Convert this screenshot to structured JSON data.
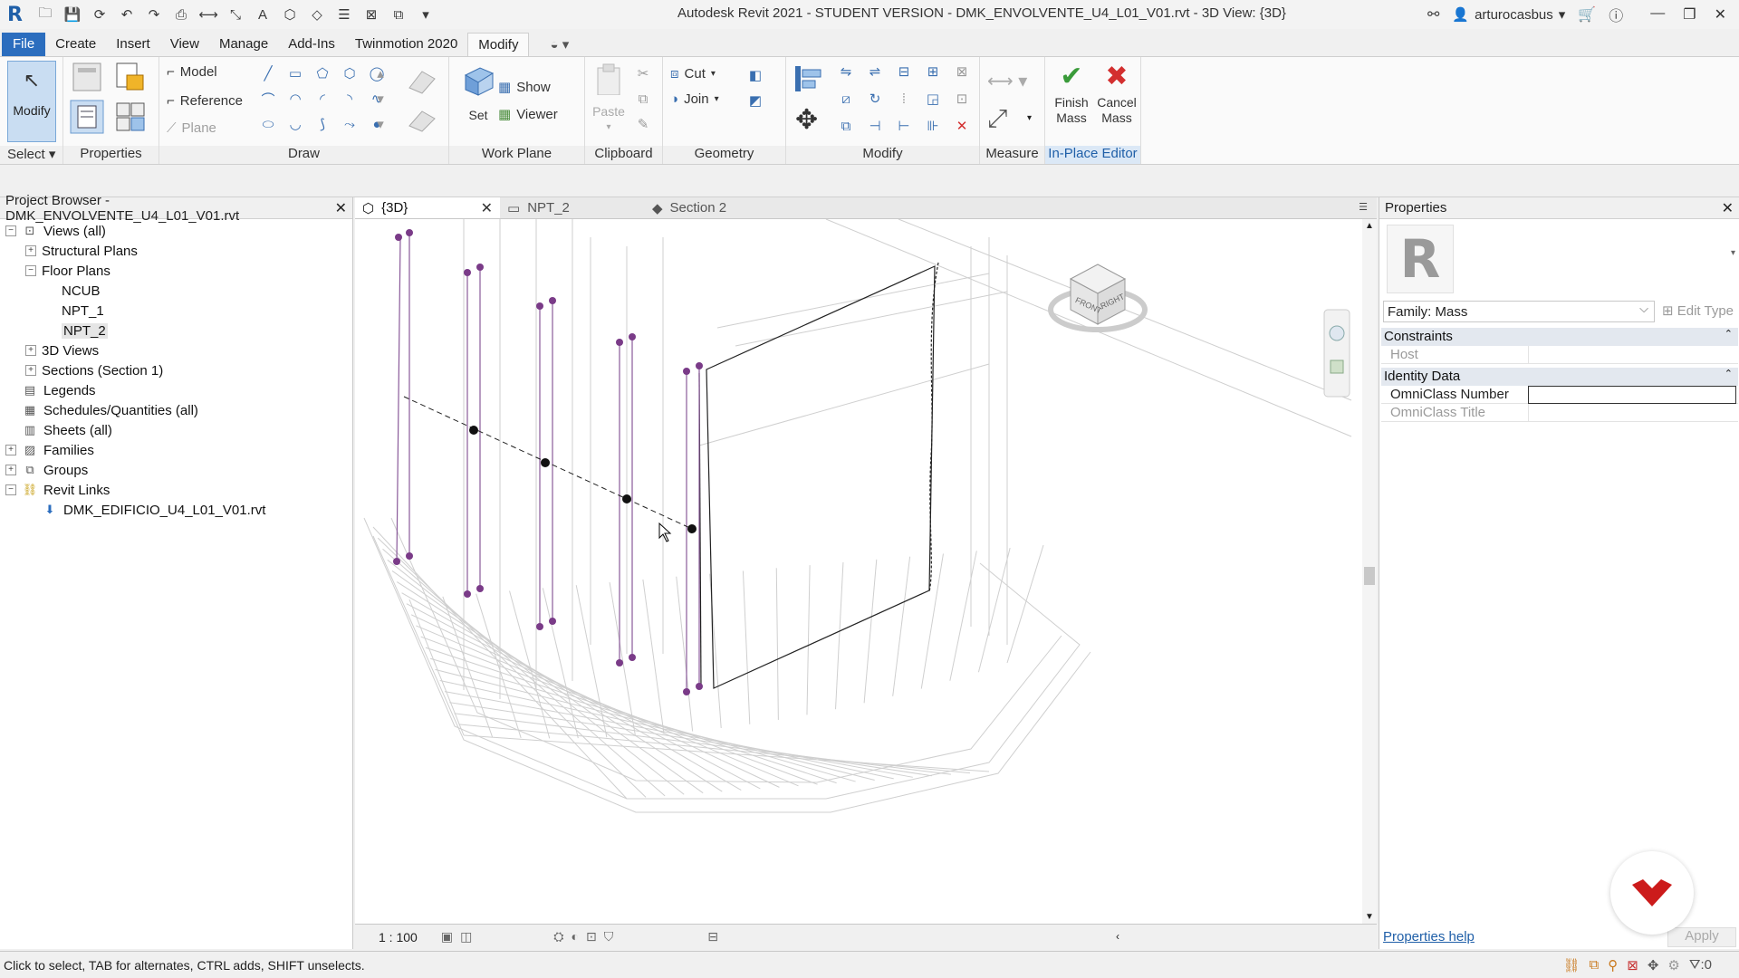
{
  "titlebar": {
    "title": "Autodesk Revit 2021 - STUDENT VERSION - DMK_ENVOLVENTE_U4_L01_V01.rvt - 3D View: {3D}",
    "user": "arturocasbus"
  },
  "ribbon_tabs": [
    "File",
    "Create",
    "Insert",
    "View",
    "Manage",
    "Add-Ins",
    "Twinmotion 2020",
    "Modify"
  ],
  "ribbon": {
    "select": {
      "modify": "Modify",
      "label": "Select"
    },
    "properties": {
      "label": "Properties"
    },
    "draw": {
      "model": "Model",
      "reference": "Reference",
      "plane": "Plane",
      "label": "Draw"
    },
    "work_plane": {
      "set": "Set",
      "show": "Show",
      "viewer": "Viewer",
      "label": "Work Plane"
    },
    "clipboard": {
      "paste": "Paste",
      "label": "Clipboard"
    },
    "geometry": {
      "cut": "Cut",
      "join": "Join",
      "label": "Geometry"
    },
    "modify": {
      "label": "Modify"
    },
    "measure": {
      "label": "Measure"
    },
    "in_place": {
      "finish_l1": "Finish",
      "finish_l2": "Mass",
      "cancel_l1": "Cancel",
      "cancel_l2": "Mass",
      "label": "In-Place Editor"
    }
  },
  "browser": {
    "title": "Project Browser - DMK_ENVOLVENTE_U4_L01_V01.rvt",
    "items": [
      {
        "label": "Views (all)",
        "level": 0,
        "exp": "−",
        "icon": "views-icon"
      },
      {
        "label": "Structural Plans",
        "level": 1,
        "exp": "+"
      },
      {
        "label": "Floor Plans",
        "level": 1,
        "exp": "−"
      },
      {
        "label": "NCUB",
        "level": 2,
        "exp": ""
      },
      {
        "label": "NPT_1",
        "level": 2,
        "exp": ""
      },
      {
        "label": "NPT_2",
        "level": 2,
        "exp": "",
        "selected": true
      },
      {
        "label": "3D Views",
        "level": 1,
        "exp": "+"
      },
      {
        "label": "Sections (Section 1)",
        "level": 1,
        "exp": "+"
      },
      {
        "label": "Legends",
        "level": 0,
        "exp": "",
        "icon": "legends-icon"
      },
      {
        "label": "Schedules/Quantities (all)",
        "level": 0,
        "exp": "",
        "icon": "schedules-icon"
      },
      {
        "label": "Sheets (all)",
        "level": 0,
        "exp": "",
        "icon": "sheets-icon"
      },
      {
        "label": "Families",
        "level": 0,
        "exp": "+",
        "icon": "families-icon"
      },
      {
        "label": "Groups",
        "level": 0,
        "exp": "+",
        "icon": "groups-icon"
      },
      {
        "label": "Revit Links",
        "level": 0,
        "exp": "−",
        "icon": "links-icon"
      },
      {
        "label": "DMK_EDIFICIO_U4_L01_V01.rvt",
        "level": 1,
        "exp": "",
        "icon": "link-arrow-icon"
      }
    ]
  },
  "view_tabs": [
    {
      "label": "{3D}",
      "active": true
    },
    {
      "label": "NPT_2",
      "active": false
    },
    {
      "label": "Section 2",
      "active": false
    }
  ],
  "view_control": {
    "scale": "1 : 100"
  },
  "viewcube": {
    "front": "FRONT",
    "right": "RIGHT"
  },
  "properties": {
    "title": "Properties",
    "family": "Family: Mass",
    "edit_type": "Edit Type",
    "groups": [
      {
        "name": "Constraints",
        "rows": [
          {
            "key": "Host",
            "value": ""
          }
        ]
      },
      {
        "name": "Identity Data",
        "rows": [
          {
            "key": "OmniClass Number",
            "value": ""
          },
          {
            "key": "OmniClass Title",
            "value": ""
          }
        ]
      }
    ],
    "help": "Properties help",
    "apply": "Apply"
  },
  "status": {
    "text": "Click to select, TAB for alternates, CTRL adds, SHIFT unselects.",
    "filter_count": ":0"
  },
  "colors": {
    "accent": "#2b6dbe",
    "grip": "#7a3b88",
    "selection_panel": "#dbe8f6"
  }
}
